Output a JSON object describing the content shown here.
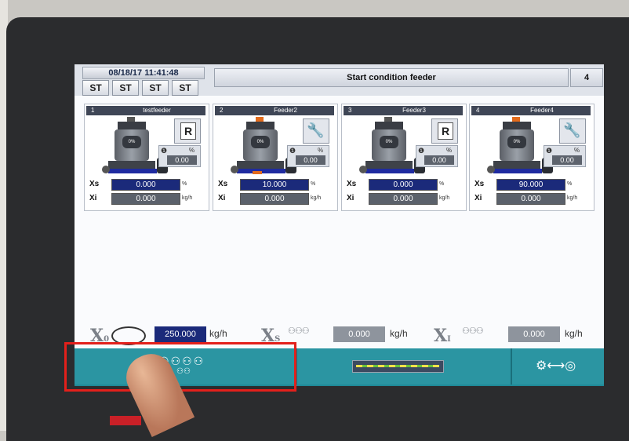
{
  "header": {
    "datetime": "08/18/17 11:41:48",
    "title": "Start condition feeder",
    "page": "4",
    "st_buttons": [
      "ST",
      "ST",
      "ST",
      "ST"
    ]
  },
  "feeders": [
    {
      "num": "1",
      "name": "testfeeder",
      "mode": "R",
      "fill": "0%",
      "pct_unit": "%",
      "pct_value": "0.00",
      "xs_label": "Xs",
      "xs": "0.000",
      "xs_unit": "%",
      "xi_label": "Xi",
      "xi": "0.000",
      "xi_unit": "kg/h"
    },
    {
      "num": "2",
      "name": "Feeder2",
      "mode": "wrench",
      "fill": "0%",
      "pct_unit": "%",
      "pct_value": "0.00",
      "xs_label": "Xs",
      "xs": "10.000",
      "xs_unit": "%",
      "xi_label": "Xi",
      "xi": "0.000",
      "xi_unit": "kg/h"
    },
    {
      "num": "3",
      "name": "Feeder3",
      "mode": "R",
      "fill": "0%",
      "pct_unit": "%",
      "pct_value": "0.00",
      "xs_label": "Xs",
      "xs": "0.000",
      "xs_unit": "%",
      "xi_label": "Xi",
      "xi": "0.000",
      "xi_unit": "kg/h"
    },
    {
      "num": "4",
      "name": "Feeder4",
      "mode": "wrench",
      "fill": "0%",
      "pct_unit": "%",
      "pct_value": "0.00",
      "xs_label": "Xs",
      "xs": "90.000",
      "xs_unit": "%",
      "xi_label": "Xi",
      "xi": "0.000",
      "xi_unit": "kg/h"
    }
  ],
  "totals": {
    "x0_label": "X",
    "x0_sub": "0",
    "x0_value": "250.000",
    "x0_unit": "kg/h",
    "xs_label": "X",
    "xs_sub": "S",
    "xs_value": "0.000",
    "xs_unit": "kg/h",
    "xi_label": "X",
    "xi_sub": "I",
    "xi_value": "0.000",
    "xi_unit": "kg/h"
  },
  "icons": {
    "feeders_nav": "feeders-overview-icon",
    "conveyor_nav": "conveyor-icon",
    "settings_nav": "io-settings-icon"
  },
  "colors": {
    "nav_bg": "#2b95a2",
    "setpoint_box": "#1b2a7a",
    "actual_box": "#5b616b",
    "highlight": "#e3201b"
  }
}
